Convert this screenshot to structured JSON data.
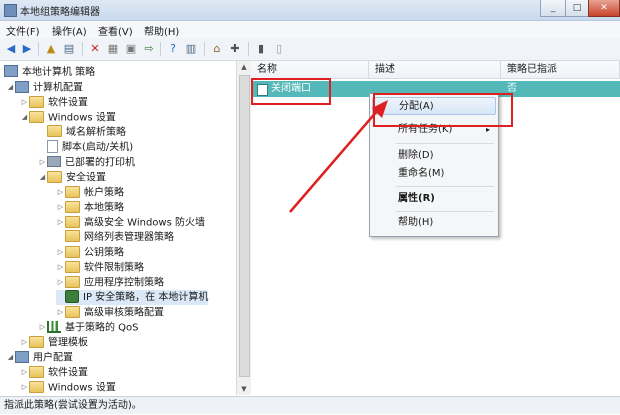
{
  "window": {
    "title": "本地组策略编辑器"
  },
  "menubar": {
    "items": [
      "文件(F)",
      "操作(A)",
      "查看(V)",
      "帮助(H)"
    ]
  },
  "tree": [
    {
      "label": "本地计算机 策略",
      "icon": "pc-icon"
    },
    {
      "label": "计算机配置",
      "icon": "pc-icon"
    },
    {
      "label": "软件设置",
      "icon": "folder-icon"
    },
    {
      "label": "Windows 设置",
      "icon": "folder-icon"
    },
    {
      "label": "域名解析策略",
      "icon": "folder-icon"
    },
    {
      "label": "脚本(启动/关机)",
      "icon": "document-icon"
    },
    {
      "label": "已部署的打印机",
      "icon": "printer-icon"
    },
    {
      "label": "安全设置",
      "icon": "folder-icon"
    },
    {
      "label": "帐户策略",
      "icon": "folder-icon"
    },
    {
      "label": "本地策略",
      "icon": "folder-icon"
    },
    {
      "label": "高级安全 Windows 防火墙",
      "icon": "folder-icon"
    },
    {
      "label": "网络列表管理器策略",
      "icon": "folder-icon"
    },
    {
      "label": "公钥策略",
      "icon": "folder-icon"
    },
    {
      "label": "软件限制策略",
      "icon": "folder-icon"
    },
    {
      "label": "应用程序控制策略",
      "icon": "folder-icon"
    },
    {
      "label": "IP 安全策略，在 本地计算机",
      "icon": "shield-icon"
    },
    {
      "label": "高级审核策略配置",
      "icon": "folder-icon"
    },
    {
      "label": "基于策略的 QoS",
      "icon": "chart-icon"
    },
    {
      "label": "管理模板",
      "icon": "folder-icon"
    },
    {
      "label": "用户配置",
      "icon": "pc-icon"
    },
    {
      "label": "软件设置",
      "icon": "folder-icon"
    },
    {
      "label": "Windows 设置",
      "icon": "folder-icon"
    }
  ],
  "list": {
    "columns": [
      "名称",
      "描述",
      "策略已指派"
    ],
    "rows": [
      {
        "name": "关闭端口",
        "description": "",
        "assigned": "否"
      }
    ]
  },
  "context_menu": {
    "items": [
      "分配(A)",
      "所有任务(K)",
      "删除(D)",
      "重命名(M)",
      "属性(R)",
      "帮助(H)"
    ],
    "submenu_arrow": "▸"
  },
  "statusbar": {
    "text": "指派此策略(尝试设置为活动)。"
  },
  "colors": {
    "selection": "#54b8b8",
    "annotation": "#e02020",
    "menu_highlight": "#d7e7f7"
  }
}
